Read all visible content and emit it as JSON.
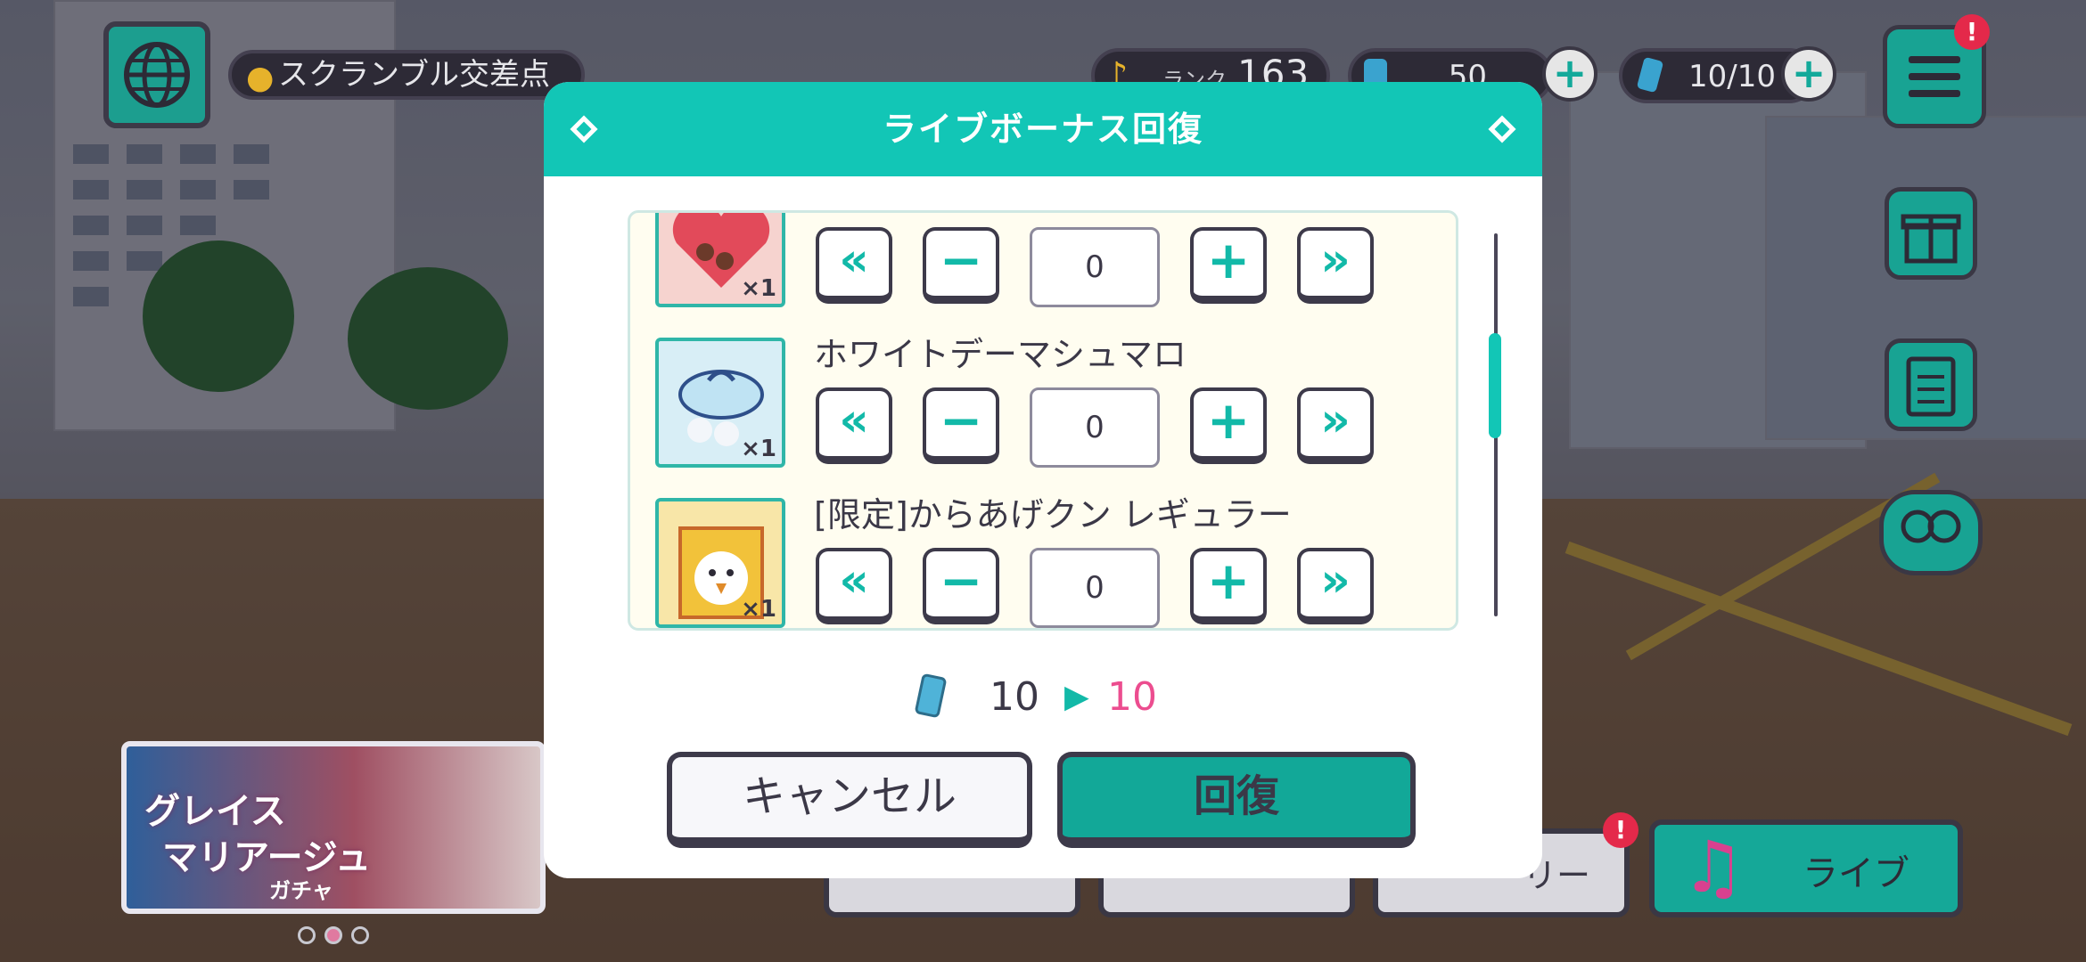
{
  "hud": {
    "location": "スクランブル交差点",
    "rank_label": "ランク",
    "rank_value": "163",
    "gems": "50",
    "energy": "10/10",
    "menu_badge": "!",
    "story_badge": "!"
  },
  "bottom_menu": {
    "story_label": "ーリー",
    "live_label": "ライブ"
  },
  "banner": {
    "title_line1": "グレイス",
    "title_line2": "マリアージュ",
    "subtitle": "ガチャ"
  },
  "dialog": {
    "title": "ライブボーナス回復",
    "items": [
      {
        "name": "",
        "icon": "heart-chocolate-box-icon",
        "count": "×1",
        "qty": "0"
      },
      {
        "name": "ホワイトデーマシュマロ",
        "icon": "marshmallow-gift-icon",
        "count": "×1",
        "qty": "0"
      },
      {
        "name": "[限定]からあげクン レギュラー",
        "icon": "karaage-kun-icon",
        "count": "×1",
        "qty": "0"
      }
    ],
    "energy_before": "10",
    "energy_after": "10",
    "cancel_label": "キャンセル",
    "recover_label": "回復"
  },
  "colors": {
    "teal": "#12c6b6",
    "pink_value": "#ec4d8f",
    "dark": "#3b3847"
  }
}
